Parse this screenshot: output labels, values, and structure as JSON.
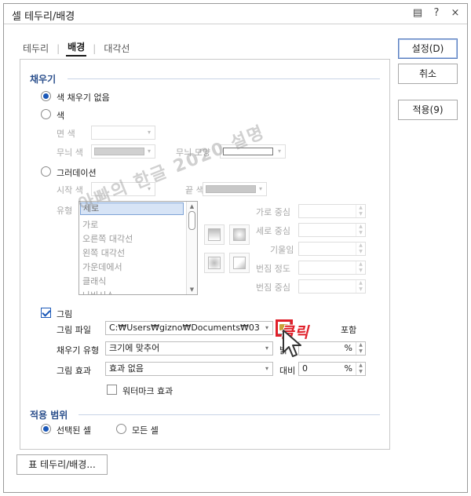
{
  "window": {
    "title": "셀 테두리/배경"
  },
  "title_icons": [
    "help-panel-icon",
    "question-icon",
    "close-icon"
  ],
  "title_glyphs": {
    "panel": "▤",
    "question": "?",
    "close": "×"
  },
  "tabs": [
    {
      "label": "테두리",
      "active": false
    },
    {
      "label": "배경",
      "active": true
    },
    {
      "label": "대각선",
      "active": false
    }
  ],
  "fill": {
    "section_title": "채우기",
    "no_fill_label": "색 채우기 없음",
    "no_fill_selected": true,
    "color_label": "색",
    "face_color_label": "면 색",
    "pattern_color_label": "무늬 색",
    "pattern_shape_label": "무늬 모양",
    "gradient_label": "그러데이션",
    "start_color_label": "시작 색",
    "end_color_label": "끝 색",
    "type_label": "유형",
    "type_options": [
      "세로",
      "가로",
      "오른쪽 대각선",
      "왼쪽 대각선",
      "가운데에서",
      "클래식",
      "나비시스"
    ],
    "type_selected": "세로",
    "h_center_label": "가로 중심",
    "v_center_label": "세로 중심",
    "tilt_label": "기울임",
    "blur_level_label": "번짐 정도",
    "blur_center_label": "번짐 중심"
  },
  "picture": {
    "checkbox_label": "그림",
    "checked": true,
    "file_label": "그림 파일",
    "file_path": "C:₩Users₩gizno₩Documents₩03",
    "include_label": "포함",
    "fill_type_label": "채우기 유형",
    "fill_type_value": "크기에 맞추어",
    "brightness_label": "밝",
    "brightness_unit": "%",
    "effect_label": "그림 효과",
    "effect_value": "효과 없음",
    "contrast_label": "대비",
    "contrast_value": "0",
    "contrast_unit": "%",
    "watermark_label": "워터마크 효과",
    "watermark_checked": false
  },
  "apply": {
    "section_title": "적용 범위",
    "selected_cells_label": "선택된 셀",
    "all_cells_label": "모든 셀",
    "selected": "selected_cells"
  },
  "buttons": {
    "ok": "설정(D)",
    "cancel": "취소",
    "apply": "적용(9)",
    "table_border": "표 테두리/배경..."
  },
  "annotation": {
    "click_text": "클릭",
    "watermark_text": "아빠의 한글 2020 설명"
  },
  "colors": {
    "accent": "#1b58b8",
    "section": "#2b4f8c",
    "highlight": "#e0202a"
  }
}
